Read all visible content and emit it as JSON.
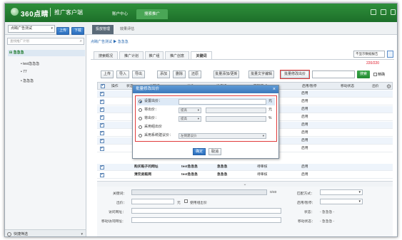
{
  "header": {
    "logo_text": "360点睛",
    "product": "推广客户端",
    "nav": [
      "账户中心",
      "搜索推广"
    ]
  },
  "subbar": {
    "account": "点睛广告测试",
    "upload": "上传",
    "download": "下载",
    "tabs": [
      "投放管理",
      "效果评估"
    ]
  },
  "sidebar": {
    "search_placeholder": "查找推广计划",
    "root": "急急急",
    "items": [
      "test急急急",
      "77",
      "急急急"
    ],
    "footer": "快捷筛选"
  },
  "main": {
    "breadcrumb": "点睛广告测试 ▶ 急急急",
    "tabs": [
      "搜索概况",
      "推广计划",
      "推广组",
      "推广创意",
      "关键词"
    ],
    "active_tab": 4,
    "report_select": "不显示数据报告",
    "count": "220/220",
    "toolbar": [
      "上传",
      "导入",
      "导出",
      "添加",
      "删除",
      "还原",
      "批量添加/更新",
      "批量文字编辑",
      "批量修改出价"
    ],
    "search_btn": "搜索",
    "exact": "精确",
    "columns": [
      "操作",
      "状态",
      "关键词",
      "出价",
      "推广组",
      "匹配方式",
      "启用/暂停",
      "移动状态",
      "出价"
    ]
  },
  "grid": {
    "rows": [
      {
        "keyword": "",
        "status": "",
        "pause": "启用"
      },
      {
        "keyword": "",
        "status": "",
        "pause": "启用"
      },
      {
        "keyword": "",
        "status": "",
        "pause": "启用"
      },
      {
        "keyword": "",
        "status": "",
        "pause": "启用"
      },
      {
        "keyword": "",
        "status": "",
        "pause": "启用"
      },
      {
        "keyword": "",
        "status": "",
        "pause": "启用"
      },
      {
        "keyword": "",
        "status": "",
        "pause": "启用"
      },
      {
        "keyword": "",
        "status": "",
        "pause": "启用"
      },
      {
        "keyword": "购买鞋子的网址",
        "group": "test急急急",
        "match": "急急急",
        "status": "待审核",
        "pause": "启用"
      },
      {
        "keyword": "清完卖鞋网",
        "group": "test急急急",
        "match": "急急急",
        "status": "待审核",
        "pause": "启用"
      }
    ]
  },
  "modal": {
    "title": "批量修改出价",
    "close": "×",
    "options": [
      {
        "label": "设置出价：",
        "unit": "元"
      },
      {
        "label": "将出价：",
        "select": "提高",
        "unit": "元"
      },
      {
        "label": "将出价：",
        "select": "提高",
        "unit": "%"
      },
      {
        "label": "采用组出价"
      },
      {
        "label": "采用系统建议价：",
        "select": "左侧建议价"
      }
    ],
    "ok": "确定",
    "cancel": "取消"
  },
  "form": {
    "keyword_label": "关键词：",
    "keyword_count": "0/40",
    "match_label": "匹配方式：",
    "price_label": "出价：",
    "price_unit": "元",
    "use_group_price": "使用组出价",
    "pause_label": "启用/暂停：",
    "url_label": "访问网址：",
    "status_label": "状态：",
    "status_value": "- 急急急 -",
    "mobile_url_label": "移动访问网址：",
    "mobile_status_label": "移动状态：",
    "mobile_status_value": "- 急急急 -"
  }
}
